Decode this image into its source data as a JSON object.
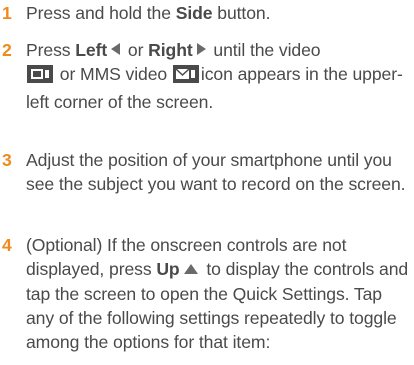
{
  "steps": [
    {
      "number": "1",
      "parts": {
        "a": "Press and hold the ",
        "b": "Side",
        "c": " button."
      }
    },
    {
      "number": "2",
      "parts": {
        "a": "Press ",
        "b": "Left",
        "c": " or ",
        "d": "Right",
        "e": " until the video",
        "f": " or MMS video ",
        "g": "icon appears in the upper-left corner of the screen."
      },
      "icons": [
        "left-arrow-icon",
        "right-arrow-icon",
        "video-mode-icon",
        "mms-video-mode-icon"
      ]
    },
    {
      "number": "3",
      "text": "Adjust the position of your smartphone until you see the subject you want to record on the screen."
    },
    {
      "number": "4",
      "parts": {
        "a": "(Optional) If the onscreen controls are not displayed, press ",
        "b": "Up",
        "c": " to display the controls and tap the screen to open the Quick Settings. Tap any of the following settings repeatedly to toggle among the options for that item:"
      },
      "icons": [
        "up-arrow-icon"
      ]
    }
  ],
  "colors": {
    "number": "#f08a1c",
    "text": "#4a4a4a",
    "glyph": "#6a6a6a"
  }
}
